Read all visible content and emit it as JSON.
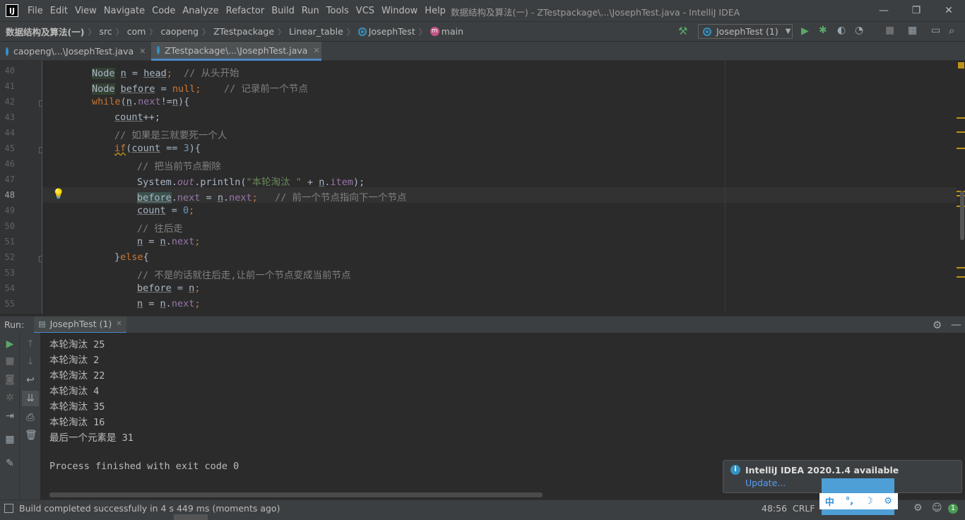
{
  "menubar": {
    "app_icon": "IJ",
    "items": [
      "File",
      "Edit",
      "View",
      "Navigate",
      "Code",
      "Analyze",
      "Refactor",
      "Build",
      "Run",
      "Tools",
      "VCS",
      "Window",
      "Help"
    ],
    "window_title": "数据结构及算法(一) - ZTestpackage\\...\\JosephTest.java - IntelliJ IDEA",
    "minimize": "—",
    "maximize": "❐",
    "close": "✕"
  },
  "navbar": {
    "crumbs": [
      "数据结构及算法(一)",
      "src",
      "com",
      "caopeng",
      "ZTestpackage",
      "Linear_table",
      "JosephTest",
      "main"
    ],
    "run_config": "JosephTest (1)"
  },
  "tabs": [
    {
      "label": "caopeng\\...\\JosephTest.java",
      "close": "✕"
    },
    {
      "label": "ZTestpackage\\...\\JosephTest.java",
      "close": "✕"
    }
  ],
  "editor": {
    "line_numbers": [
      "40",
      "41",
      "42",
      "43",
      "44",
      "45",
      "46",
      "47",
      "48",
      "49",
      "50",
      "51",
      "52",
      "53",
      "54",
      "55"
    ],
    "lines": {
      "l40_type": "Node",
      "l40_var": "n",
      "l40_eq": " = ",
      "l40_val": "head",
      "l40_semi": ";",
      "l40_comment": "  // 从头开始",
      "l41_type": "Node",
      "l41_var": "before",
      "l41_eq": " = ",
      "l41_val": "null",
      "l41_semi": ";",
      "l41_comment": "    // 记录前一个节点",
      "l42_kw": "while",
      "l42_a": "(",
      "l42_n1": "n",
      "l42_dot": ".",
      "l42_next": "next",
      "l42_op": "!=",
      "l42_n2": "n",
      "l42_end": "){",
      "l43_count": "count",
      "l43_rest": "++;",
      "l44_comment": "// 如果是三就要死一个人",
      "l45_kw": "if",
      "l45_a": "(",
      "l45_count": "count",
      "l45_op": " == ",
      "l45_num": "3",
      "l45_end": "){",
      "l46_comment": "// 把当前节点删除",
      "l47_sys": "System.",
      "l47_out": "out",
      "l47_println": ".println(",
      "l47_str": "\"本轮淘汰 \"",
      "l47_plus": " + ",
      "l47_n": "n",
      "l47_dot": ".",
      "l47_item": "item",
      "l47_end": ");",
      "l48_before": "before",
      "l48_dot": ".",
      "l48_next": "next",
      "l48_eq": " = ",
      "l48_n": "n",
      "l48_dot2": ".",
      "l48_next2": "next",
      "l48_semi": ";",
      "l48_comment": "   // 前一个节点指向下一个节点",
      "l49_count": "count",
      "l49_eq": " = ",
      "l49_num": "0",
      "l49_semi": ";",
      "l50_comment": "// 往后走",
      "l51_n": "n",
      "l51_eq": " = ",
      "l51_n2": "n",
      "l51_dot": ".",
      "l51_next": "next",
      "l51_semi": ";",
      "l52_brace": "}",
      "l52_kw": "else",
      "l52_end": "{",
      "l53_comment": "// 不是的话就往后走,让前一个节点变成当前节点",
      "l54_before": "before",
      "l54_eq": " = ",
      "l54_n": "n",
      "l54_semi": ";",
      "l55_n": "n",
      "l55_eq": " = ",
      "l55_n2": "n",
      "l55_dot": ".",
      "l55_next": "next",
      "l55_semi": ";"
    }
  },
  "run_panel": {
    "label": "Run:",
    "tab_label": "JosephTest (1)",
    "tab_close": "✕",
    "output": [
      "本轮淘汰 25",
      "本轮淘汰 2",
      "本轮淘汰 22",
      "本轮淘汰 4",
      "本轮淘汰 35",
      "本轮淘汰 16",
      "最后一个元素是 31",
      "",
      "Process finished with exit code 0"
    ]
  },
  "notification": {
    "title": "IntelliJ IDEA 2020.1.4 available",
    "link": "Update..."
  },
  "ime": {
    "items": [
      "中",
      "°,",
      "☽",
      "⚙"
    ]
  },
  "statusbar": {
    "message": "Build completed successfully in 4 s 449 ms (moments ago)",
    "position": "48:56",
    "line_sep": "CRLF",
    "badge": "1"
  },
  "colors": {
    "accent": "#4a88c7",
    "keyword": "#cc7832",
    "comment": "#808080",
    "field": "#9876aa",
    "number": "#6897bb",
    "string": "#6a8759"
  }
}
